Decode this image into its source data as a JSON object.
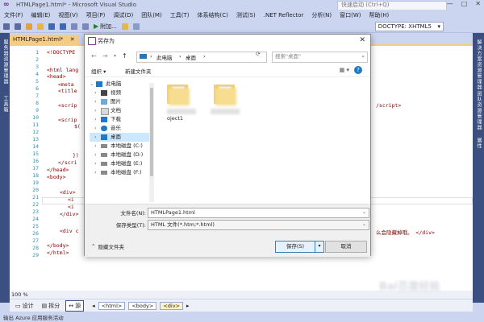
{
  "window": {
    "title": "HTMLPage1.html* - Microsoft Visual Studio",
    "quick_launch": "快速启动 (Ctrl+Q)",
    "controls": [
      "—",
      "□",
      "✕"
    ]
  },
  "menu": [
    "文件(F)",
    "编辑(E)",
    "视图(V)",
    "项目(P)",
    "调试(D)",
    "团队(M)",
    "工具(T)",
    "体系结构(C)",
    "测试(S)",
    ".NET Reflector",
    "分析(N)",
    "窗口(W)",
    "帮助(H)"
  ],
  "toolbar": {
    "attach": "附加...",
    "doctype": "DOCTYPE: XHTML5"
  },
  "left_strip": [
    "服务器资源管理器",
    "工具箱"
  ],
  "right_strip": [
    "解决方案资源管理器",
    "团队资源管理器",
    "属性"
  ],
  "editor": {
    "tab": "HTMLPage1.html*",
    "lines": [
      "1",
      "2",
      "3",
      "4",
      "5",
      "6",
      "7",
      "8",
      "9",
      "10",
      "11",
      "12",
      "13",
      "14",
      "15",
      "16",
      "17",
      "18",
      "19",
      "20",
      "21",
      "22",
      "23",
      "24",
      "25",
      "26",
      "27",
      "28",
      "29"
    ],
    "code": {
      "l1": "<!DOCTYPE",
      "l3": "<html lang",
      "l4": "<head>",
      "l5": "<meta",
      "l6": "<title",
      "l8": "<scrip",
      "l10": "<scrip",
      "l11": "$(",
      "l15": "})",
      "l16": "</scri",
      "l17": "</head>",
      "l18": "<body>",
      "l20": "<div>",
      "l21": "<i",
      "l22": "<i",
      "l23": "</div>",
      "l25": "<div c",
      "l27": "</body>",
      "l28": "</html>"
    },
    "code_right": {
      "r8": "/script>",
      "r25": "么会隐藏掉哦。 </div>"
    }
  },
  "zoom": "100 %",
  "view_tabs": [
    "设计",
    "拆分",
    "源"
  ],
  "breadcrumbs": [
    "<html>",
    "<body>",
    "<div>"
  ],
  "status": "输出    Azure 应用服务活动",
  "dialog": {
    "title": "另存为",
    "close": "✕",
    "address": [
      "此电脑",
      "桌面"
    ],
    "search_placeholder": "搜索\"桌面\"",
    "organize": "组织 ▾",
    "new_folder": "新建文件夹",
    "nav": [
      "此电脑",
      "视频",
      "图片",
      "文档",
      "下载",
      "音乐",
      "桌面",
      "本地磁盘 (C:)",
      "本地磁盘 (D:)",
      "本地磁盘 (E:)",
      "本地磁盘 (F:)"
    ],
    "folder_labels": [
      "oject1"
    ],
    "file_name_label": "文件名(N):",
    "file_name": "HTMLPage1.html",
    "type_label": "保存类型(T):",
    "type_value": "HTML 文件(*.htm;*.html)",
    "hide_folders": "隐藏文件夹",
    "save": "保存(S)",
    "cancel": "取消"
  },
  "watermark": "Bai百度经验",
  "colors": {
    "chrome": "#ccd5f0",
    "strip": "#3b4f81",
    "tab": "#f5cc84",
    "selection": "#cce8ff"
  }
}
